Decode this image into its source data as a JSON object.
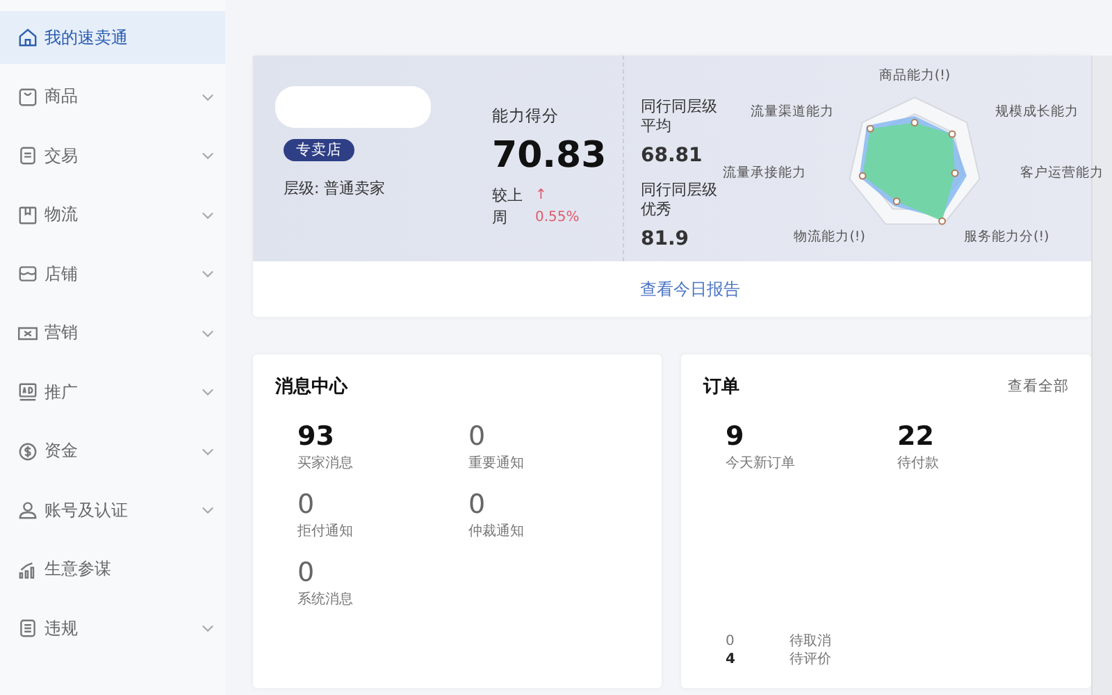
{
  "sidebar": {
    "items": [
      {
        "label": "我的速卖通",
        "selected": true,
        "kind": "link"
      },
      {
        "label": "商品",
        "selected": false,
        "kind": "group"
      },
      {
        "label": "交易",
        "selected": false,
        "kind": "group"
      },
      {
        "label": "物流",
        "selected": false,
        "kind": "group"
      },
      {
        "label": "店铺",
        "selected": false,
        "kind": "group"
      },
      {
        "label": "营销",
        "selected": false,
        "kind": "group"
      },
      {
        "label": "推广",
        "selected": false,
        "kind": "group"
      },
      {
        "label": "资金",
        "selected": false,
        "kind": "group"
      },
      {
        "label": "账号及认证",
        "selected": false,
        "kind": "group"
      },
      {
        "label": "生意参谋",
        "selected": false,
        "kind": "link"
      },
      {
        "label": "违规",
        "selected": false,
        "kind": "group"
      }
    ]
  },
  "store_card": {
    "badge": "专卖店",
    "level": "层级: 普通卖家",
    "score_label": "能力得分",
    "score": "70.83",
    "change_label": "较上周",
    "change_arrow": "↑",
    "change": "0.55%",
    "peers": [
      {
        "label": "同行同层级平均",
        "value": "68.81"
      },
      {
        "label": "同行同层级优秀",
        "value": "81.9"
      }
    ],
    "radar_axes": [
      "商品能力(!)",
      "流量渠道能力",
      "规模成长能力",
      "流量承接能力",
      "客户运营能力",
      "物流能力(!)",
      "服务能力分(!)"
    ],
    "report_link": "查看今日报告"
  },
  "messages": {
    "title": "消息中心",
    "stats": [
      {
        "value": "93",
        "label": "买家消息",
        "highlighted": true
      },
      {
        "value": "0",
        "label": "重要通知",
        "highlighted": false
      },
      {
        "value": "0",
        "label": "拒付通知",
        "highlighted": false
      },
      {
        "value": "0",
        "label": "仲裁通知",
        "highlighted": false
      },
      {
        "value": "0",
        "label": "系统消息",
        "highlighted": false
      }
    ]
  },
  "orders": {
    "title": "订单",
    "view_all": "查看全部",
    "stats": [
      {
        "value": "9",
        "label": "今天新订单",
        "highlighted": true
      },
      {
        "value": "22",
        "label": "待付款",
        "highlighted": true
      }
    ],
    "pending": [
      {
        "value": "0",
        "label": "待取消",
        "highlighted": false
      },
      {
        "value": "4",
        "label": "待评价",
        "highlighted": true
      }
    ]
  }
}
